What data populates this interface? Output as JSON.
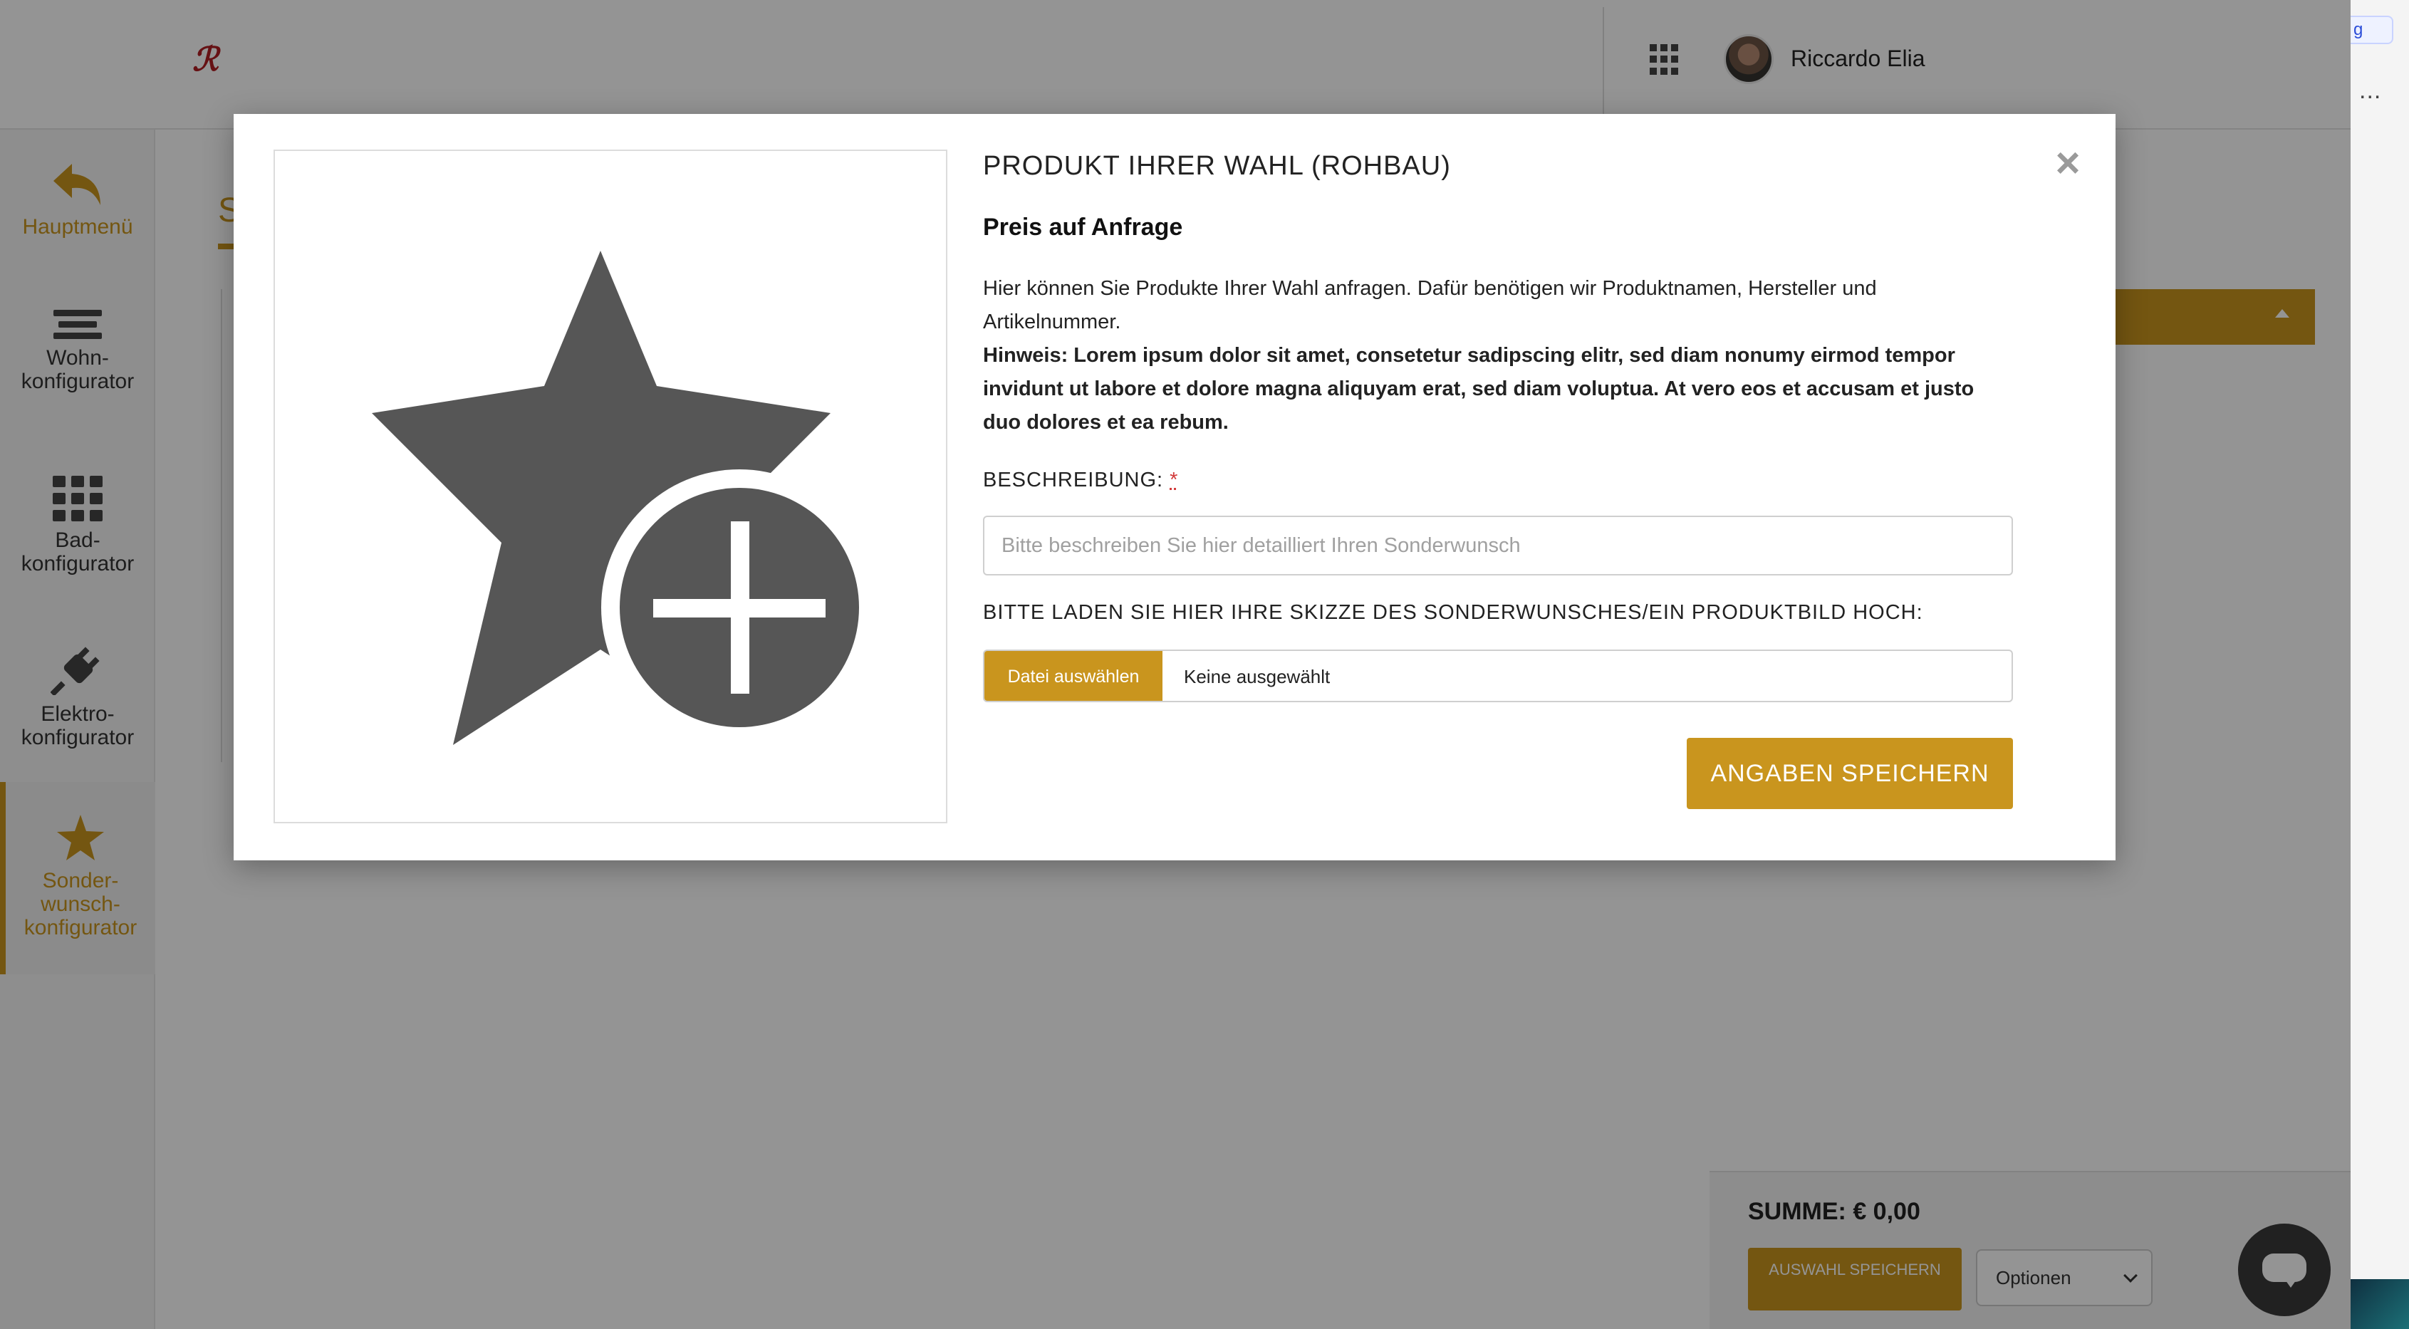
{
  "header": {
    "logo_text": "ℛ",
    "user_name": "Riccardo Elia"
  },
  "sidebar": {
    "items": [
      {
        "label": "Hauptmenü",
        "icon": "back-arrow-icon"
      },
      {
        "label": "Wohn-\nkonfigurator",
        "icon": "bars-icon"
      },
      {
        "label": "Bad-\nkonfigurator",
        "icon": "grid-icon"
      },
      {
        "label": "Elektro-\nkonfigurator",
        "icon": "plug-icon"
      },
      {
        "label": "Sonder-\nwunsch-\nkonfigurator",
        "icon": "star-icon"
      }
    ]
  },
  "background": {
    "tab_letter": "S"
  },
  "right_strip": {
    "lang": "g",
    "more": "..."
  },
  "modal": {
    "title": "PRODUKT IHRER WAHL (ROHBAU)",
    "price": "Preis auf Anfrage",
    "description": "Hier können Sie Produkte Ihrer Wahl anfragen. Dafür benötigen wir Produktnamen, Hersteller und Artikelnummer.",
    "hint": "Hinweis: Lorem ipsum dolor sit amet, consetetur sadipscing elitr, sed diam nonumy eirmod tempor invidunt ut labore et dolore magna aliquyam erat, sed diam voluptua. At vero eos et accusam et justo duo dolores et ea rebum.",
    "description_label": "BESCHREIBUNG:",
    "required_mark": "*",
    "description_placeholder": "Bitte beschreiben Sie hier detailliert Ihren Sonderwunsch",
    "description_value": "",
    "upload_label": "BITTE LADEN SIE HIER IHRE SKIZZE DES SONDERWUNSCHES/EIN PRODUKTBILD HOCH:",
    "file_button": "Datei auswählen",
    "file_status": "Keine ausgewählt",
    "save_button": "ANGABEN SPEICHERN",
    "close": "×",
    "image_icon": "star-plus-icon"
  },
  "summary": {
    "sum_label": "SUMME: € 0,00",
    "save_selection": "AUSWAHL SPEICHERN",
    "options_value": "Optionen"
  },
  "colors": {
    "accent": "#c9951e",
    "logo": "#b01e23",
    "icon_dark": "#555555"
  }
}
